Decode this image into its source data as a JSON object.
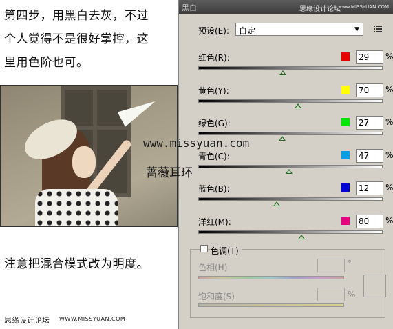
{
  "left": {
    "intro_lines": [
      "第四步，用黑白去灰，不过",
      "个人觉得不是很好掌控，这",
      "里用色阶也可。"
    ],
    "watermark_url": "www.missyuan.com",
    "watermark_signature": "蔷薇耳环",
    "note": "注意把混合模式改为明度。",
    "footer_brand": "思缘设计论坛",
    "footer_url": "WWW.MISSYUAN.COM"
  },
  "dialog": {
    "title": "黑白",
    "title_brand": "思缘设计论坛",
    "title_url": "www.MISSYUAN.COM",
    "preset_label": "预设(E):",
    "preset_value": "自定",
    "sliders": [
      {
        "label": "红色(R):",
        "value": "29",
        "level": 29,
        "swatch": "#e60000"
      },
      {
        "label": "黄色(Y):",
        "value": "70",
        "level": 70,
        "swatch": "#ffff00"
      },
      {
        "label": "绿色(G):",
        "value": "27",
        "level": 27,
        "swatch": "#00e600"
      },
      {
        "label": "青色(C):",
        "value": "47",
        "level": 47,
        "swatch": "#00a0e6"
      },
      {
        "label": "蓝色(B):",
        "value": "12",
        "level": 12,
        "swatch": "#0000d2"
      },
      {
        "label": "洋红(M):",
        "value": "80",
        "level": 80,
        "swatch": "#e6007e"
      }
    ],
    "percent": "%",
    "tint_label": "色调(T)",
    "hue_label": "色相(H)",
    "hue_unit": "°",
    "saturation_label": "饱和度(S)",
    "saturation_unit": "%"
  }
}
